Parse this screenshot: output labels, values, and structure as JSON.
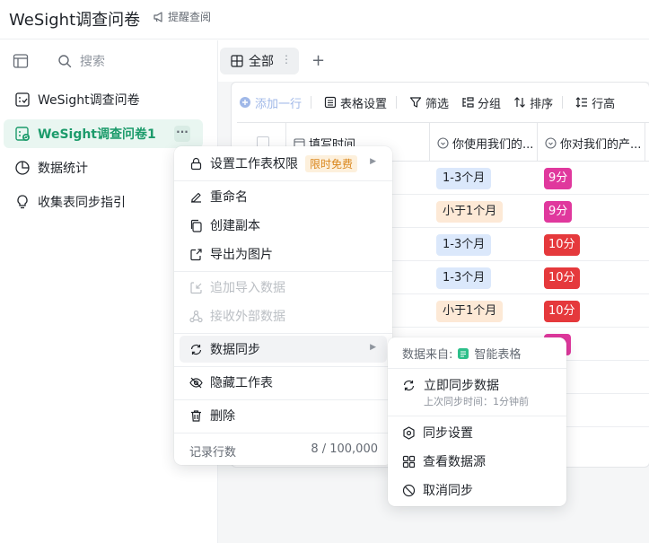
{
  "header": {
    "title": "WeSight调查问卷",
    "remind_label": "提醒查阅"
  },
  "sidebar": {
    "search_label": "搜索",
    "items": [
      {
        "label": "WeSight调查问卷"
      },
      {
        "label": "WeSight调查问卷1",
        "more": "···"
      },
      {
        "label": "数据统计"
      },
      {
        "label": "收集表同步指引"
      }
    ]
  },
  "tabs": {
    "active_label": "全部",
    "more": "⋮",
    "add": "+"
  },
  "toolbar": {
    "add_row": "添加一行",
    "table_settings": "表格设置",
    "filter": "筛选",
    "group": "分组",
    "sort": "排序",
    "row_height": "行高"
  },
  "table": {
    "columns": [
      "填写时间",
      "你使用我们的...",
      "你对我们的产..."
    ],
    "rows": [
      {
        "duration": "1-3个月",
        "duration_color": "blue",
        "score": "9分",
        "score_color": "pink"
      },
      {
        "duration": "小于1个月",
        "duration_color": "peach",
        "score": "9分",
        "score_color": "pink"
      },
      {
        "duration": "1-3个月",
        "duration_color": "blue",
        "score": "10分",
        "score_color": "red"
      },
      {
        "duration": "1-3个月",
        "duration_color": "blue",
        "score": "10分",
        "score_color": "red"
      },
      {
        "duration": "小于1个月",
        "duration_color": "peach",
        "score": "10分",
        "score_color": "red"
      }
    ]
  },
  "menu": {
    "permission": "设置工作表权限",
    "permission_badge": "限时免费",
    "rename": "重命名",
    "duplicate": "创建副本",
    "export_image": "导出为图片",
    "append_import": "追加导入数据",
    "receive_external": "接收外部数据",
    "data_sync": "数据同步",
    "hide_sheet": "隐藏工作表",
    "delete": "删除",
    "record_rows_label": "记录行数",
    "record_rows_value": "8 / 100,000"
  },
  "submenu": {
    "source_label": "数据来自:",
    "source_value": "智能表格",
    "sync_now": "立即同步数据",
    "last_sync": "上次同步时间：1分钟前",
    "sync_settings": "同步设置",
    "view_source": "查看数据源",
    "cancel_sync": "取消同步"
  },
  "colors": {
    "accent_green": "#1c9b6b",
    "tag_blue": "#dbe8fb",
    "tag_peach": "#fde9d6",
    "score_pink": "#e0389d",
    "score_red": "#e5393c",
    "badge_orange": "#d9861c"
  }
}
